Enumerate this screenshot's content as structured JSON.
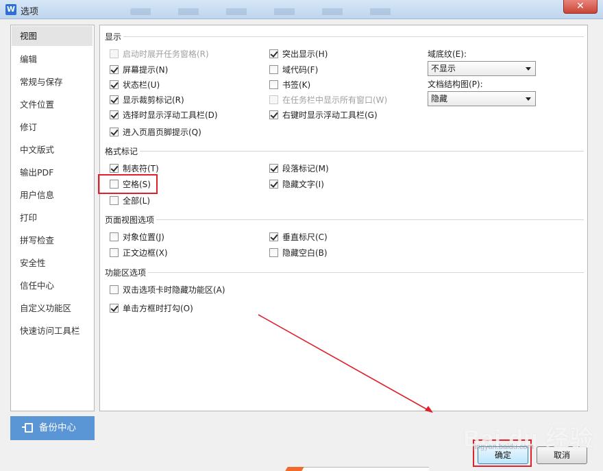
{
  "window": {
    "title": "选项",
    "app_icon_letter": "W",
    "close_label": "✕"
  },
  "nav": {
    "items": [
      {
        "label": "视图",
        "active": true
      },
      {
        "label": "编辑"
      },
      {
        "label": "常规与保存"
      },
      {
        "label": "文件位置"
      },
      {
        "label": "修订"
      },
      {
        "label": "中文版式"
      },
      {
        "label": "输出PDF"
      },
      {
        "label": "用户信息"
      },
      {
        "label": "打印"
      },
      {
        "label": "拼写检查"
      },
      {
        "label": "安全性"
      },
      {
        "label": "信任中心"
      },
      {
        "label": "自定义功能区"
      },
      {
        "label": "快速访问工具栏"
      }
    ],
    "backup_label": "备份中心"
  },
  "sections": {
    "display": {
      "title": "显示",
      "left": [
        {
          "label": "启动时展开任务窗格(R)",
          "checked": false,
          "disabled": true
        },
        {
          "label": "屏幕提示(N)",
          "checked": true
        },
        {
          "label": "状态栏(U)",
          "checked": true
        },
        {
          "label": "显示裁剪标记(R)",
          "checked": true
        },
        {
          "label": "选择时显示浮动工具栏(D)",
          "checked": true
        },
        {
          "label": "进入页眉页脚提示(Q)",
          "checked": true
        }
      ],
      "middle": [
        {
          "label": "突出显示(H)",
          "checked": true
        },
        {
          "label": "域代码(F)",
          "checked": false
        },
        {
          "label": "书签(K)",
          "checked": false
        },
        {
          "label": "在任务栏中显示所有窗口(W)",
          "checked": false,
          "disabled": true
        },
        {
          "label": "右键时显示浮动工具栏(G)",
          "checked": true
        }
      ],
      "field_shading_label": "域底纹(E):",
      "field_shading_value": "不显示",
      "doc_map_label": "文档结构图(P):",
      "doc_map_value": "隐藏"
    },
    "format_marks": {
      "title": "格式标记",
      "left": [
        {
          "label": "制表符(T)",
          "checked": true
        },
        {
          "label": "空格(S)",
          "checked": false
        },
        {
          "label": "全部(L)",
          "checked": false
        }
      ],
      "middle": [
        {
          "label": "段落标记(M)",
          "checked": true
        },
        {
          "label": "隐藏文字(I)",
          "checked": true
        }
      ]
    },
    "page_view": {
      "title": "页面视图选项",
      "left": [
        {
          "label": "对象位置(J)",
          "checked": false
        },
        {
          "label": "正文边框(X)",
          "checked": false
        }
      ],
      "middle": [
        {
          "label": "垂直标尺(C)",
          "checked": true
        },
        {
          "label": "隐藏空白(B)",
          "checked": false
        }
      ]
    },
    "ribbon": {
      "title": "功能区选项",
      "items": [
        {
          "label": "双击选项卡时隐藏功能区(A)",
          "checked": false
        },
        {
          "label": "单击方框时打勾(O)",
          "checked": true
        }
      ]
    }
  },
  "buttons": {
    "ok": "确定",
    "cancel": "取消"
  },
  "watermark": {
    "text": "Bai du 经验",
    "sub": "jingyan.baidu.com"
  },
  "colors": {
    "highlight": "#e0202a",
    "backup_bg": "#5a95d6"
  }
}
